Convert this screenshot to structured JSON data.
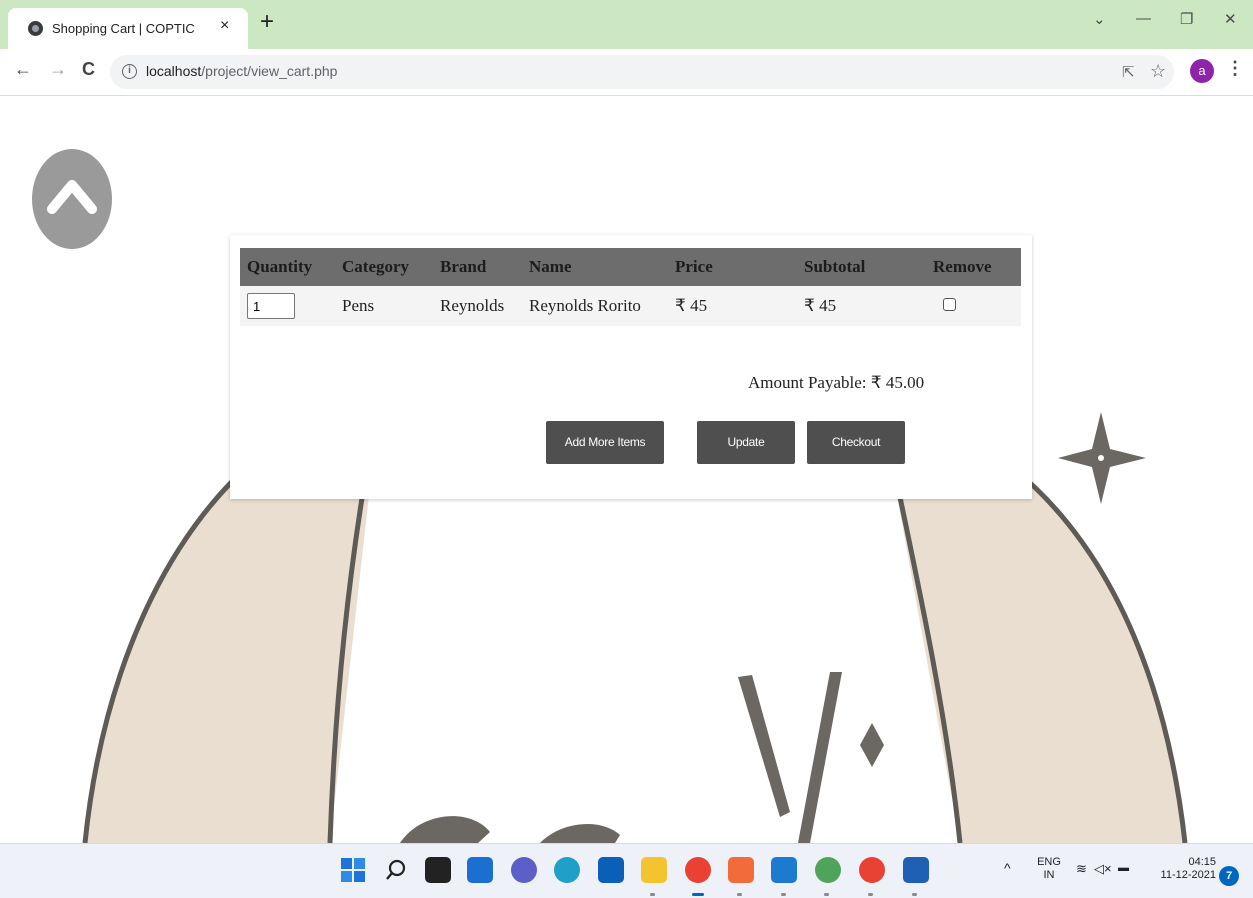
{
  "browser": {
    "tab_title": "Shopping Cart | COPTIC",
    "tab_close": "×",
    "new_tab": "+",
    "url_host": "localhost",
    "url_path": "/project/view_cart.php",
    "profile_initial": "a",
    "icons": [
      "back-icon",
      "forward-icon",
      "reload-icon",
      "info-icon",
      "share-icon",
      "star-icon",
      "kebab-menu-icon"
    ]
  },
  "cart": {
    "headers": [
      "Quantity",
      "Category",
      "Brand",
      "Name",
      "Price",
      "Subtotal",
      "Remove"
    ],
    "rows": [
      {
        "quantity": "1",
        "category": "Pens",
        "brand": "Reynolds",
        "name": "Reynolds Rorito",
        "price": "₹ 45",
        "subtotal": "₹ 45",
        "remove_checked": false
      }
    ],
    "amount_payable": "Amount Payable: ₹ 45.00",
    "buttons": {
      "add_more": "Add More Items",
      "update": "Update",
      "checkout": "Checkout"
    }
  },
  "taskbar": {
    "language": "ENG",
    "region": "IN",
    "time": "04:15",
    "date": "11-12-2021",
    "notification_count": "7"
  },
  "colors": {
    "tab_strip": "#cce8c3",
    "table_header": "#6d6d6d",
    "button": "#4f4f4f",
    "bg_ring": "#eaded0",
    "bg_outline": "#5e5a55",
    "profile": "#8e24aa"
  }
}
